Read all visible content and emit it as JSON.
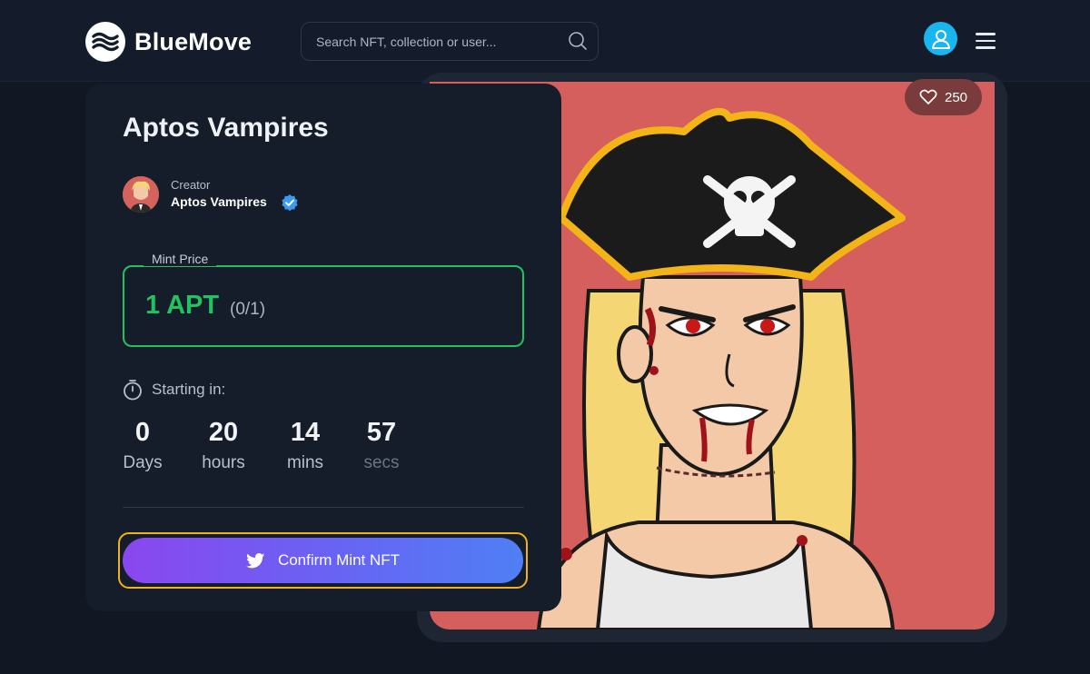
{
  "header": {
    "brand": "BlueMove",
    "search_placeholder": "Search NFT, collection or user...",
    "icons": [
      "bluemove-logo-icon",
      "search-icon",
      "user-icon",
      "hamburger-menu-icon"
    ]
  },
  "nft": {
    "likes": "250",
    "title": "Aptos Vampires",
    "creator_label": "Creator",
    "creator_name": "Aptos Vampires",
    "mint_label": "Mint Price",
    "mint_price": "1 APT",
    "mint_count": "(0/1)"
  },
  "countdown": {
    "label": "Starting in:",
    "items": [
      {
        "value": "0",
        "unit": "Days"
      },
      {
        "value": "20",
        "unit": "hours"
      },
      {
        "value": "14",
        "unit": "mins"
      },
      {
        "value": "57",
        "unit": "secs"
      }
    ]
  },
  "action": {
    "confirm_label": "Confirm Mint NFT"
  },
  "colors": {
    "background": "#111723",
    "card": "#151c2a",
    "accent_green": "#22c35e",
    "highlight_border": "#f0b418",
    "button_gradient_start": "#8a47ee",
    "button_gradient_end": "#4f7ff4",
    "artwork_bg": "#d45f5c",
    "user_icon_bg": "#19b5ee"
  }
}
